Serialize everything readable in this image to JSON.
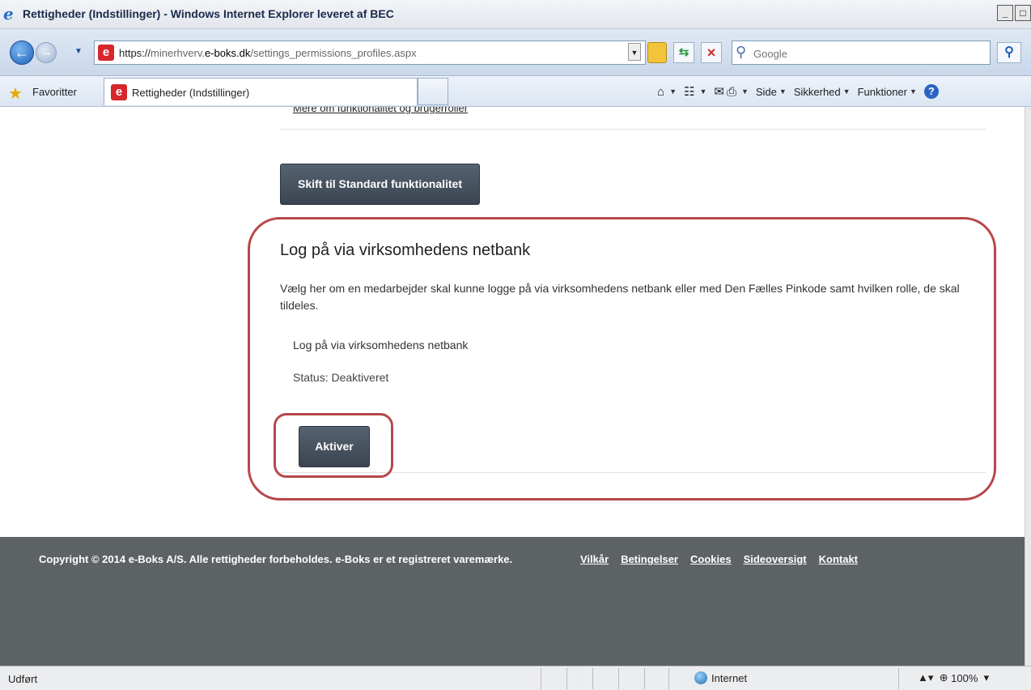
{
  "window": {
    "title": "Rettigheder (Indstillinger) - Windows Internet Explorer leveret af BEC",
    "minimize": "_",
    "maximize": "□",
    "close": "✕"
  },
  "address": {
    "scheme": "https://",
    "subdomain": "minerhverv.",
    "host": "e-boks.dk",
    "path": "/settings_permissions_profiles.aspx"
  },
  "search": {
    "placeholder": "Google"
  },
  "favorites": {
    "label": "Favoritter"
  },
  "tab": {
    "label": "Rettigheder (Indstillinger)"
  },
  "commandbar": {
    "side": "Side",
    "security": "Sikkerhed",
    "tools": "Funktioner"
  },
  "content": {
    "cut_link": "Mere om funktionalitet og brugerroller",
    "switch_button": "Skift til Standard funktionalitet",
    "section_title": "Log på via virksomhedens netbank",
    "section_desc": "Vælg her om en medarbejder skal kunne logge på via virksomhedens netbank eller med Den Fælles Pinkode samt hvilken rolle, de skal tildeles.",
    "row_label": "Log på via virksomhedens netbank",
    "status": "Status: Deaktiveret",
    "activate_button": "Aktiver"
  },
  "footer": {
    "copyright": "Copyright © 2014 e-Boks A/S. Alle rettigheder forbeholdes. e-Boks er et registreret varemærke.",
    "links": [
      "Vilkår",
      "Betingelser",
      "Cookies",
      "Sideoversigt",
      "Kontakt"
    ]
  },
  "statusbar": {
    "status": "Udført",
    "zone": "Internet",
    "zoom": "100%"
  },
  "colors": {
    "highlight": "#b8474a",
    "button": "#3b4551",
    "footer": "#5d6264"
  }
}
